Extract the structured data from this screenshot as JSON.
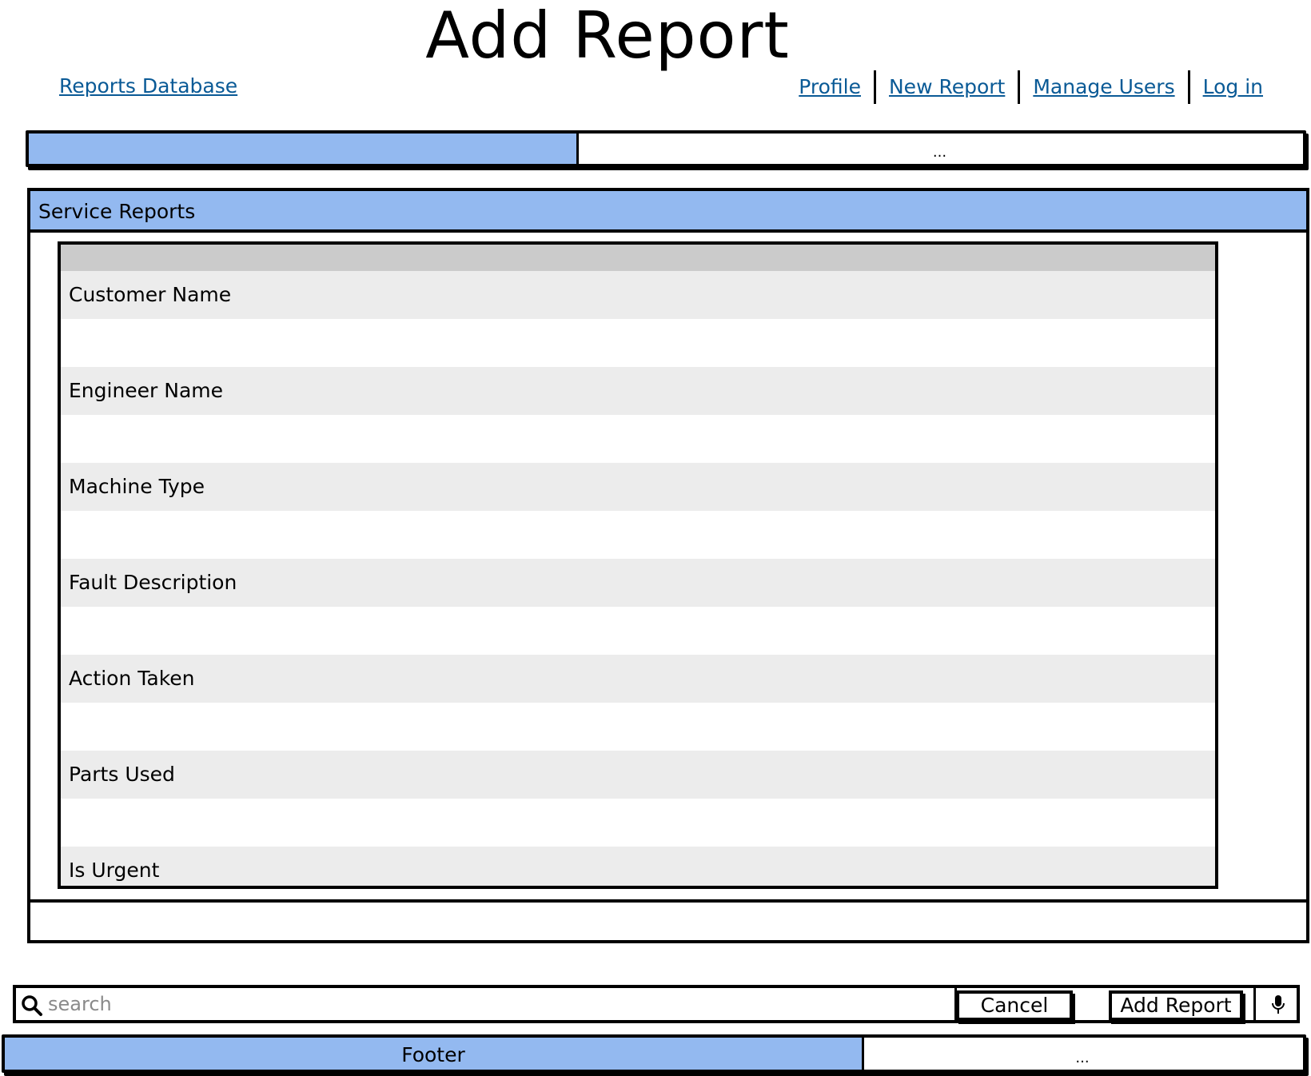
{
  "page": {
    "title": "Add Report"
  },
  "nav": {
    "home_link": "Reports Database",
    "links": [
      "Profile",
      "New Report",
      "Manage Users",
      "Log in"
    ]
  },
  "progress_top": {
    "value": 0.43,
    "tail_text": "..."
  },
  "panel": {
    "title": "Service Reports"
  },
  "form": {
    "fields": [
      "Customer Name",
      "Engineer Name",
      "Machine Type",
      "Fault Description",
      "Action Taken",
      "Parts Used",
      "Is Urgent"
    ]
  },
  "toolbar": {
    "search_placeholder": "search",
    "search_icon": "search-icon",
    "cancel_label": "Cancel",
    "add_label": "Add Report",
    "mic_icon": "microphone-icon"
  },
  "footer": {
    "label": "Footer",
    "value": 0.66,
    "tail_text": "..."
  },
  "colors": {
    "accent": "#93b9f0",
    "link": "#0a5a96",
    "row_label_bg": "#ececec",
    "list_header_bg": "#cbcbcb"
  }
}
